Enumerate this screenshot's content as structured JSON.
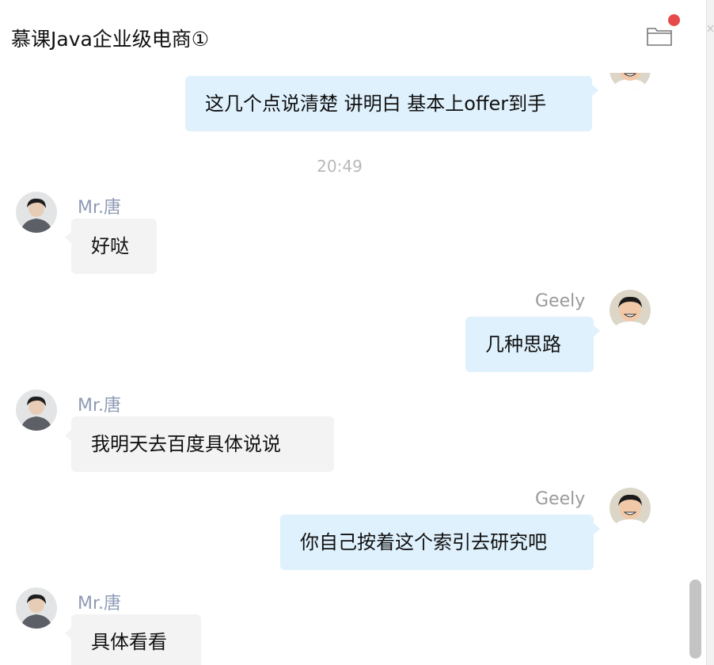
{
  "header": {
    "title": "慕课Java企业级电商①",
    "folder_icon": "folder-icon",
    "notification_color": "#e74a4a"
  },
  "messages": [
    {
      "sender": "",
      "side": "right",
      "text": "这几个点说清楚 讲明白 基本上offer到手"
    },
    {
      "type": "timestamp",
      "text": "20:49"
    },
    {
      "sender": "Mr.唐",
      "side": "left",
      "text": "好哒"
    },
    {
      "sender": "Geely",
      "side": "right",
      "text": "几种思路"
    },
    {
      "sender": "Mr.唐",
      "side": "left",
      "text": "我明天去百度具体说说"
    },
    {
      "sender": "Geely",
      "side": "right",
      "text": "你自己按着这个索引去研究吧"
    },
    {
      "sender": "Mr.唐",
      "side": "left",
      "text": "具体看看"
    }
  ],
  "colors": {
    "incoming_bubble": "#f3f3f3",
    "outgoing_bubble": "#dff1fd",
    "incoming_name": "#8e9bb5",
    "outgoing_name": "#9a9a9a"
  }
}
